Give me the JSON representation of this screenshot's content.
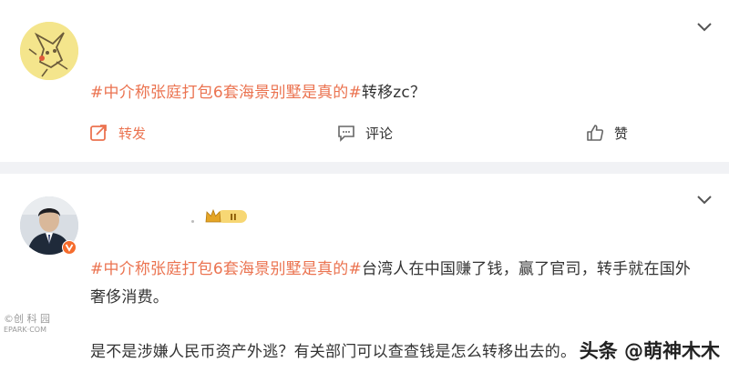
{
  "post1": {
    "hashtag": "#中介称张庭打包6套海景别墅是真的#",
    "text": "转移zc？",
    "repost_label": "转发",
    "comment_label": "评论",
    "like_label": "赞"
  },
  "post2": {
    "hashtag": "#中介称张庭打包6套海景别墅是真的#",
    "line1_text": "台湾人在中国赚了钱，赢了官司，转手就在国外",
    "line2": "奢侈消费。",
    "line3": "是不是涉嫌人民币资产外逃？有关部门可以查查钱是怎么转移出去的。",
    "vip_level": "II"
  },
  "watermark": {
    "line1": "©创 科 园",
    "line2": "EPARK·COM"
  },
  "toutiao_mark": "头条 @萌神木木",
  "colors": {
    "accent": "#eb7350",
    "separator": "#f1f2f5"
  }
}
